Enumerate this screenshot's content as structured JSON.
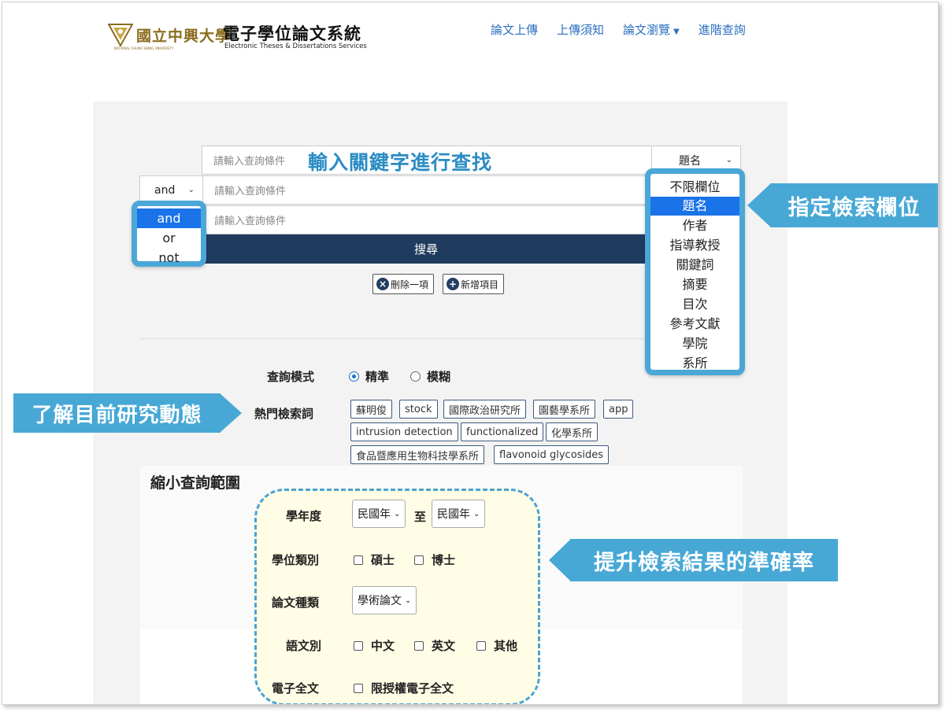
{
  "header": {
    "logo_name": "國立中興大學",
    "logo_en": "NATIONAL CHUNG HSING UNIVERSITY",
    "system_title": "電子學位論文系統",
    "system_subtitle": "Electronic Theses & Dissertations Services"
  },
  "nav": {
    "items": [
      {
        "label": "論文上傳"
      },
      {
        "label": "上傳須知"
      },
      {
        "label": "論文瀏覽",
        "dropdown": true
      },
      {
        "label": "進階查詢"
      }
    ]
  },
  "search": {
    "placeholder": "請輸入查詢條件",
    "row1_field_value": "題名",
    "row2_operator_value": "and",
    "submit_label": "搜尋",
    "delete_label": "刪除一項",
    "add_label": "新增項目",
    "operator_options": [
      "and",
      "or",
      "not"
    ],
    "operator_selected": "and",
    "field_options": [
      "不限欄位",
      "題名",
      "作者",
      "指導教授",
      "關鍵詞",
      "摘要",
      "目次",
      "參考文獻",
      "學院",
      "系所"
    ],
    "field_selected": "題名"
  },
  "mode": {
    "label": "查詢模式",
    "options": [
      {
        "label": "精準",
        "checked": true
      },
      {
        "label": "模糊",
        "checked": false
      }
    ]
  },
  "hot": {
    "label": "熱門檢索詞",
    "tags": [
      "蘇明俊",
      "stock",
      "國際政治研究所",
      "園藝學系所",
      "app",
      "intrusion detection",
      "functionalized",
      "化學系所",
      "食品暨應用生物科技學系所",
      "flavonoid glycosides"
    ]
  },
  "narrow": {
    "title": "縮小查詢範圍",
    "year_label": "學年度",
    "year_from": "民國年",
    "year_to_label": "至",
    "year_to": "民國年",
    "degree_label": "學位類別",
    "degree_options": [
      "碩士",
      "博士"
    ],
    "type_label": "論文種類",
    "type_value": "學術論文",
    "lang_label": "語文別",
    "lang_options": [
      "中文",
      "英文",
      "其他"
    ],
    "fulltext_label": "電子全文",
    "fulltext_option": "限授權電子全文"
  },
  "annotations": {
    "keyword": "輸入關鍵字進行查找",
    "field": "指定檢索欄位",
    "trend": "了解目前研究動態",
    "accuracy": "提升檢索結果的準確率"
  },
  "colors": {
    "accent": "#47a8d6",
    "nav_link": "#2d6fc0",
    "search_button": "#1f3b5e",
    "selected_option": "#1a73e8",
    "dashed_box_bg": "#fffde6"
  }
}
